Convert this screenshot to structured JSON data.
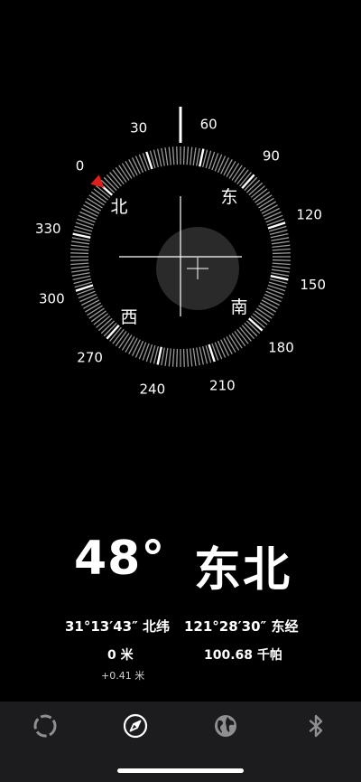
{
  "compass": {
    "heading_degrees": 48,
    "degree_labels": [
      "0",
      "30",
      "60",
      "90",
      "120",
      "150",
      "180",
      "210",
      "240",
      "270",
      "300",
      "330"
    ],
    "cardinals": {
      "north": "北",
      "east": "东",
      "south": "南",
      "west": "西"
    },
    "marker_color": "#e0201b",
    "level_bubble_color": "#2a2a2a"
  },
  "reading": {
    "degrees": "48°",
    "direction": "东北"
  },
  "location": {
    "latitude": "31°13′43″ 北纬",
    "longitude": "121°28′30″ 东经",
    "altitude": "0 米",
    "altitude_accuracy": "+0.41 米",
    "pressure": "100.68 千帕"
  },
  "tabbar": {
    "tabs": [
      {
        "name": "level",
        "icon": "level-icon",
        "active": false
      },
      {
        "name": "compass",
        "icon": "compass-icon",
        "active": true
      },
      {
        "name": "globe",
        "icon": "globe-icon",
        "active": false
      },
      {
        "name": "bluetooth",
        "icon": "bluetooth-icon",
        "active": false
      }
    ]
  }
}
